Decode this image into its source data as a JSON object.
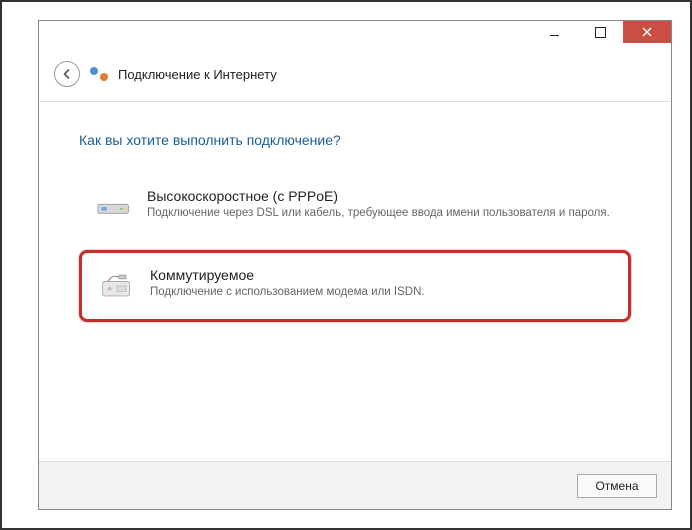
{
  "window": {
    "title": "Подключение к Интернету"
  },
  "content": {
    "question": "Как вы хотите выполнить подключение?",
    "options": [
      {
        "title": "Высокоскоростное (с PPPoE)",
        "description": "Подключение через DSL или кабель, требующее ввода имени пользователя и пароля."
      },
      {
        "title": "Коммутируемое",
        "description": "Подключение с использованием модема или ISDN."
      }
    ]
  },
  "footer": {
    "cancel": "Отмена"
  }
}
